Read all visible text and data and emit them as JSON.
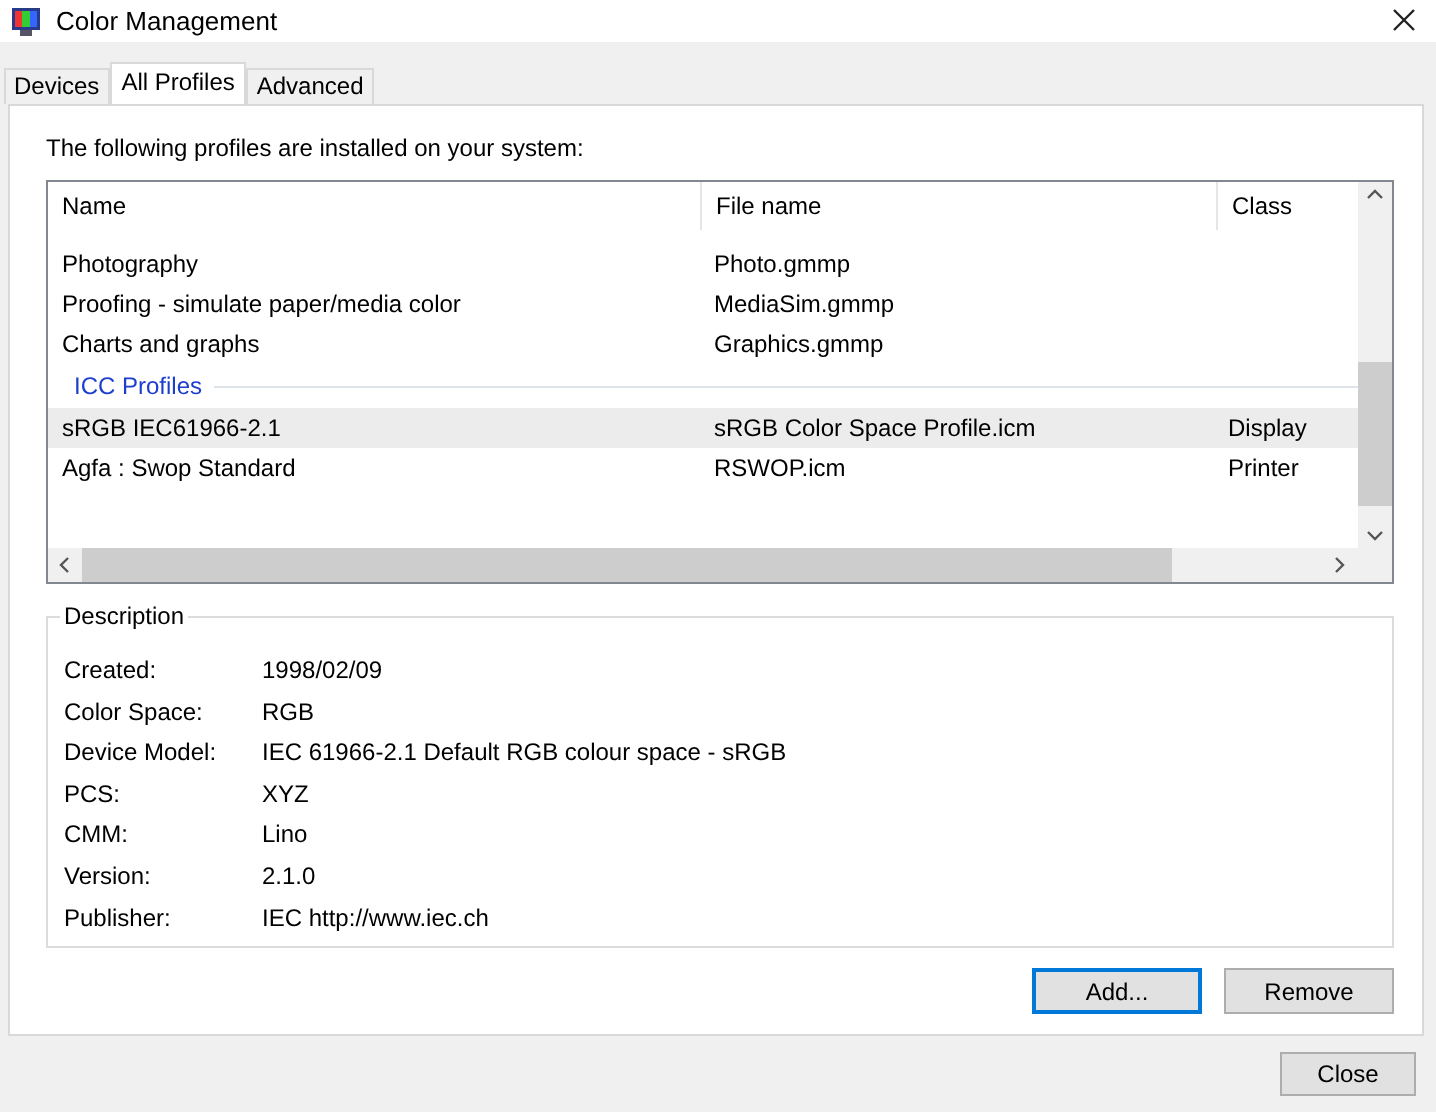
{
  "window": {
    "title": "Color Management"
  },
  "tabs": [
    {
      "label": "Devices",
      "selected": false
    },
    {
      "label": "All Profiles",
      "selected": true
    },
    {
      "label": "Advanced",
      "selected": false
    }
  ],
  "intro": "The following profiles are installed on your system:",
  "profiles": {
    "columns": [
      "Name",
      "File name",
      "Class"
    ],
    "rows": [
      {
        "kind": "item",
        "name": "Photography",
        "file": "Photo.gmmp",
        "selected": false
      },
      {
        "kind": "item",
        "name": "Proofing - simulate paper/media color",
        "file": "MediaSim.gmmp",
        "selected": false
      },
      {
        "kind": "item",
        "name": "Charts and graphs",
        "file": "Graphics.gmmp",
        "selected": false
      },
      {
        "kind": "group",
        "name": "ICC Profiles"
      },
      {
        "kind": "item",
        "name": "sRGB IEC61966-2.1",
        "file": "sRGB Color Space Profile.icm",
        "class": "Display",
        "selected": true
      },
      {
        "kind": "item",
        "name": "Agfa : Swop Standard",
        "file": "RSWOP.icm",
        "class": "Printer",
        "selected": false
      }
    ]
  },
  "description": {
    "title": "Description",
    "fields": [
      {
        "label": "Created:",
        "value": "1998/02/09"
      },
      {
        "label": "Color Space:",
        "value": "RGB"
      },
      {
        "label": "Device Model:",
        "value": "IEC 61966-2.1 Default RGB colour space - sRGB"
      },
      {
        "label": "PCS:",
        "value": "XYZ"
      },
      {
        "label": "CMM:",
        "value": "Lino"
      },
      {
        "label": "Version:",
        "value": "2.1.0"
      },
      {
        "label": "Publisher:",
        "value": "IEC http://www.iec.ch"
      }
    ]
  },
  "buttons": [
    {
      "label": "Add...",
      "focused": true
    },
    {
      "label": "Remove",
      "focused": false
    }
  ],
  "footer_buttons": [
    {
      "label": "Close",
      "focused": false
    }
  ]
}
